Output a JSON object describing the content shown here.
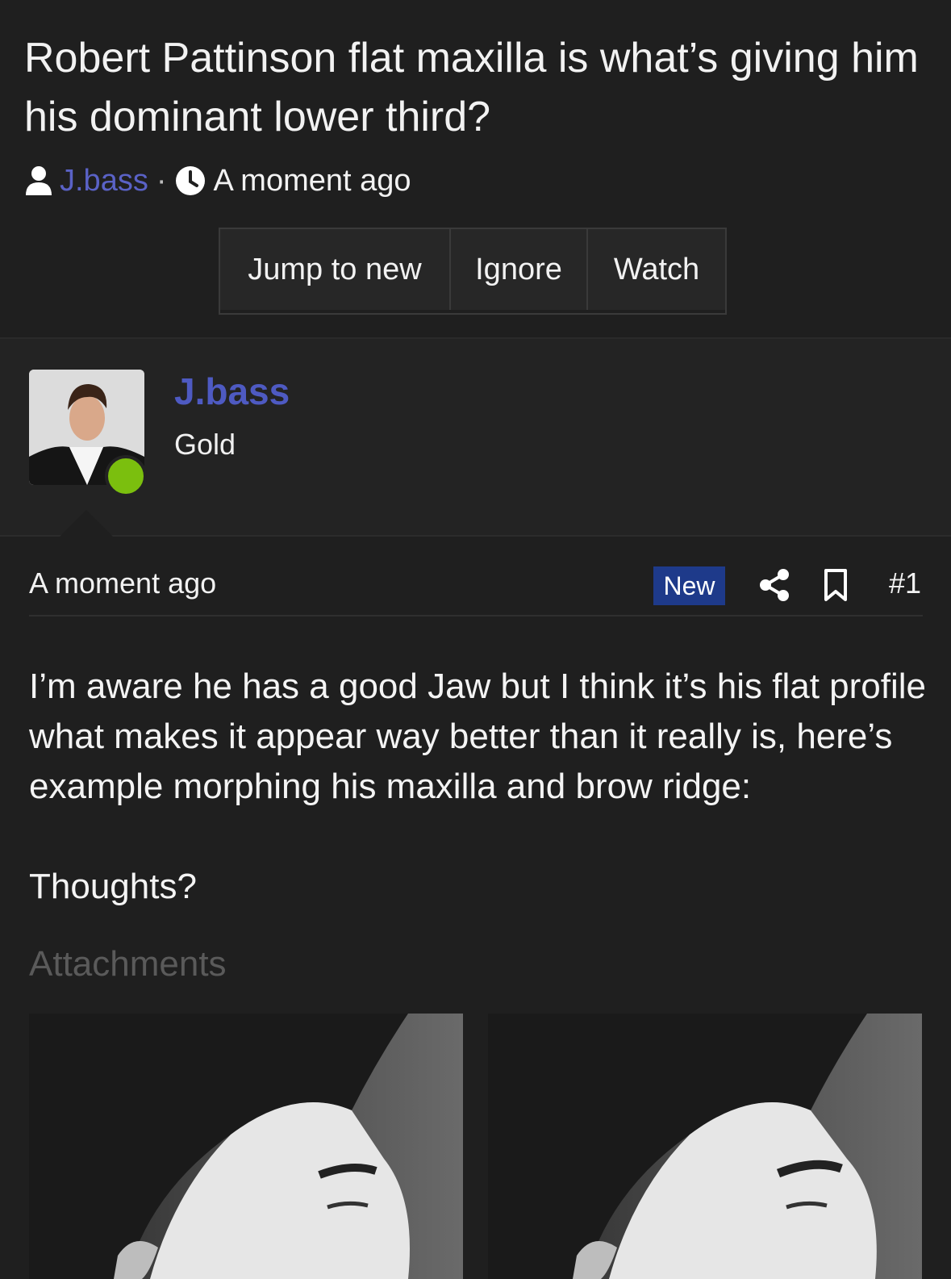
{
  "thread": {
    "title": "Robert Pattinson flat maxilla is what’s giving him his dominant lower third?",
    "author": "J.bass",
    "separator": "·",
    "time": "A moment ago",
    "buttons": {
      "jump": "Jump to new",
      "ignore": "Ignore",
      "watch": "Watch"
    }
  },
  "user": {
    "name": "J.bass",
    "title": "Gold",
    "online": true
  },
  "post": {
    "time": "A moment ago",
    "badge": "New",
    "number": "#1",
    "body_line1": "I’m aware he has a good Jaw but I think it’s his flat profile what makes it appear way better than it really is, here’s example morphing his maxilla and brow ridge:",
    "body_line2": "Thoughts?",
    "attachments_label": "Attachments",
    "attachments": [
      "profile-photo-original",
      "profile-photo-morphed"
    ]
  },
  "colors": {
    "background": "#1f1f1f",
    "link": "#4e5ac2",
    "badge": "#1e3a8a",
    "online": "#7bbf0e"
  },
  "icons": {
    "user": "user-icon",
    "clock": "clock-icon",
    "share": "share-icon",
    "bookmark": "bookmark-icon"
  }
}
